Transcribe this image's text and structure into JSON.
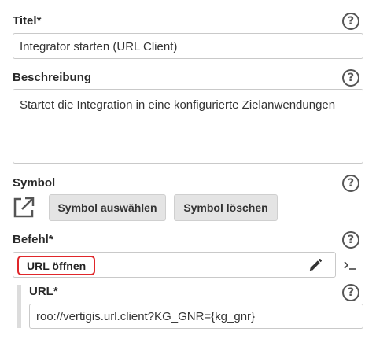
{
  "title_field": {
    "label": "Titel*",
    "value": "Integrator starten (URL Client)"
  },
  "description_field": {
    "label": "Beschreibung",
    "value": "Startet die Integration in eine konfigurierte Zielanwendungen"
  },
  "symbol_field": {
    "label": "Symbol",
    "select_button": "Symbol auswählen",
    "delete_button": "Symbol löschen",
    "icon": "external-link-icon"
  },
  "command_field": {
    "label": "Befehl*",
    "value": "URL öffnen",
    "edit_icon": "pencil-icon",
    "terminal_icon": "terminal-icon",
    "highlight_color": "#e0262a"
  },
  "url_field": {
    "label": "URL*",
    "value": "roo://vertigis.url.client?KG_GNR={kg_gnr}"
  },
  "help_glyph": "?"
}
